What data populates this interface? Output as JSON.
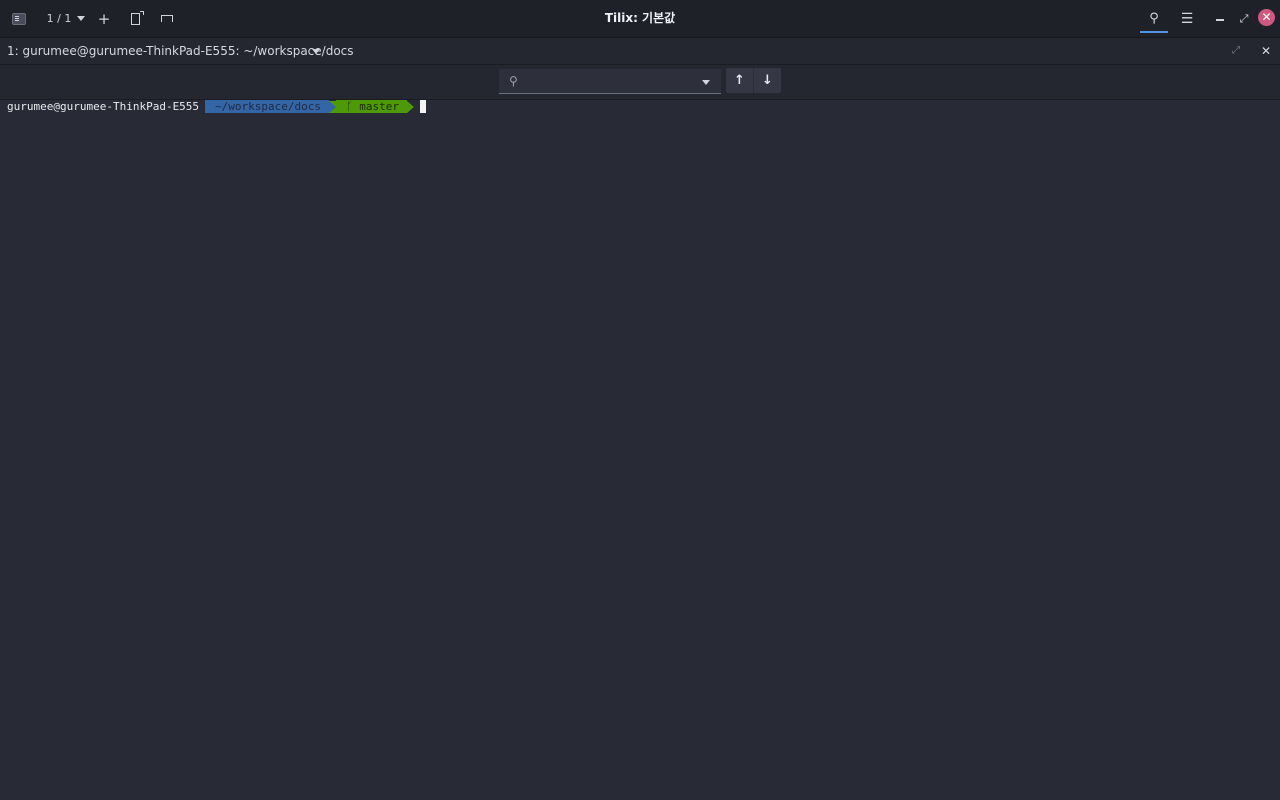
{
  "header": {
    "title": "Tilix: 기본값",
    "session_counter": "1 / 1",
    "add_label": "+",
    "menu_glyph": "☰",
    "maximize_glyph": "⤢",
    "close_glyph": "✕",
    "search_glyph": "⚲"
  },
  "terminal_bar": {
    "title": "1: gurumee@gurumee-ThinkPad-E555: ~/workspace/docs",
    "maximize_glyph": "⤢",
    "close_glyph": "✕"
  },
  "find": {
    "value": "",
    "placeholder": "",
    "prev_glyph": "↑",
    "next_glyph": "↓",
    "search_glyph": "⚲"
  },
  "prompt": {
    "host": "gurumee@gurumee-ThinkPad-E555",
    "dir": "~/workspace/docs",
    "branch": "ᚴ master"
  },
  "colors": {
    "background": "#282a36",
    "accent": "#5294e2",
    "dir_segment": "#3465a4",
    "git_segment": "#4e9a06",
    "close_button": "#d0587e"
  }
}
